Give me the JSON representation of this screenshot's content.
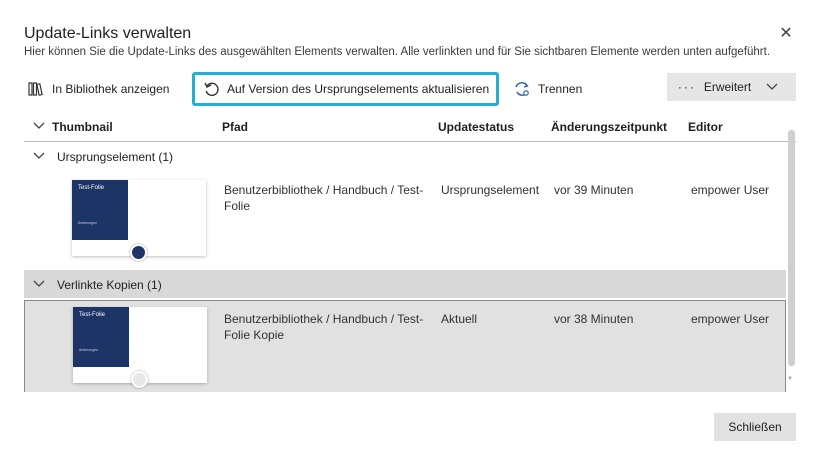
{
  "dialog": {
    "title": "Update-Links verwalten",
    "subtitle": "Hier können Sie die Update-Links des ausgewählten Elements verwalten. Alle verlinkten und für Sie sichtbaren Elemente werden unten aufgeführt.",
    "close_icon": "close-icon"
  },
  "toolbar": {
    "library_label": "In Bibliothek anzeigen",
    "update_label": "Auf Version des Ursprungselements aktualisieren",
    "separate_label": "Trennen",
    "advanced_dots": "···",
    "advanced_label": "Erweitert"
  },
  "table": {
    "columns": [
      "Thumbnail",
      "Pfad",
      "Updatestatus",
      "Änderungszeitpunkt",
      "Editor"
    ],
    "groups": [
      {
        "label": "Ursprungselement (1)",
        "rows": [
          {
            "thumb_title": "Test-Folie",
            "thumb_sub": "Änderungen",
            "path_line1": "Benutzerbibliothek / Handbuch / Test-",
            "path_line2": "Folie",
            "status": "Ursprungselement",
            "changed": "vor 39 Minuten",
            "editor": "empower User"
          }
        ]
      },
      {
        "label": "Verlinkte Kopien (1)",
        "rows": [
          {
            "thumb_title": "Test-Folie",
            "thumb_sub": "Änderungen",
            "path_line1": "Benutzerbibliothek / Handbuch / Test-",
            "path_line2": "Folie Kopie",
            "status": "Aktuell",
            "changed": "vor 38 Minuten",
            "editor": "empower User"
          }
        ]
      }
    ]
  },
  "footer": {
    "close_label": "Schließen"
  },
  "colors": {
    "highlight": "#1fb0d4",
    "slide": "#1c3466",
    "selected_row": "#e1e1e1"
  }
}
